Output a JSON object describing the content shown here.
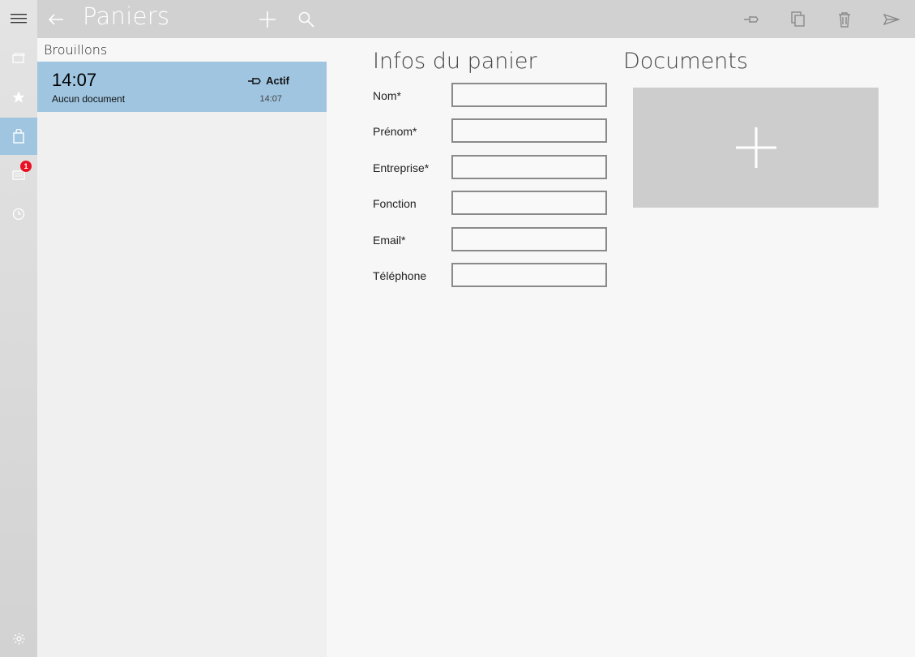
{
  "header": {
    "title": "Paniers"
  },
  "list": {
    "group_label": "Brouillons",
    "items": [
      {
        "time": "14:07",
        "subtitle": "Aucun document",
        "status": "Actif",
        "time_small": "14:07"
      }
    ]
  },
  "rail": {
    "notification_count": "1"
  },
  "form": {
    "section_title": "Infos du panier",
    "fields": [
      {
        "label": "Nom*",
        "value": ""
      },
      {
        "label": "Prénom*",
        "value": ""
      },
      {
        "label": "Entreprise*",
        "value": ""
      },
      {
        "label": "Fonction",
        "value": ""
      },
      {
        "label": "Email*",
        "value": ""
      },
      {
        "label": "Téléphone",
        "value": ""
      }
    ]
  },
  "documents": {
    "section_title": "Documents"
  },
  "icons": {
    "menu": "hamburger-icon",
    "back": "back-arrow-icon",
    "add": "plus-icon",
    "search": "search-icon",
    "pin": "pin-icon",
    "copy": "copy-icon",
    "delete": "trash-icon",
    "send": "send-icon",
    "settings": "gear-icon"
  },
  "colors": {
    "selected": "#9fc5e0",
    "topbar": "#d1d1d1",
    "badge": "#e81123"
  }
}
